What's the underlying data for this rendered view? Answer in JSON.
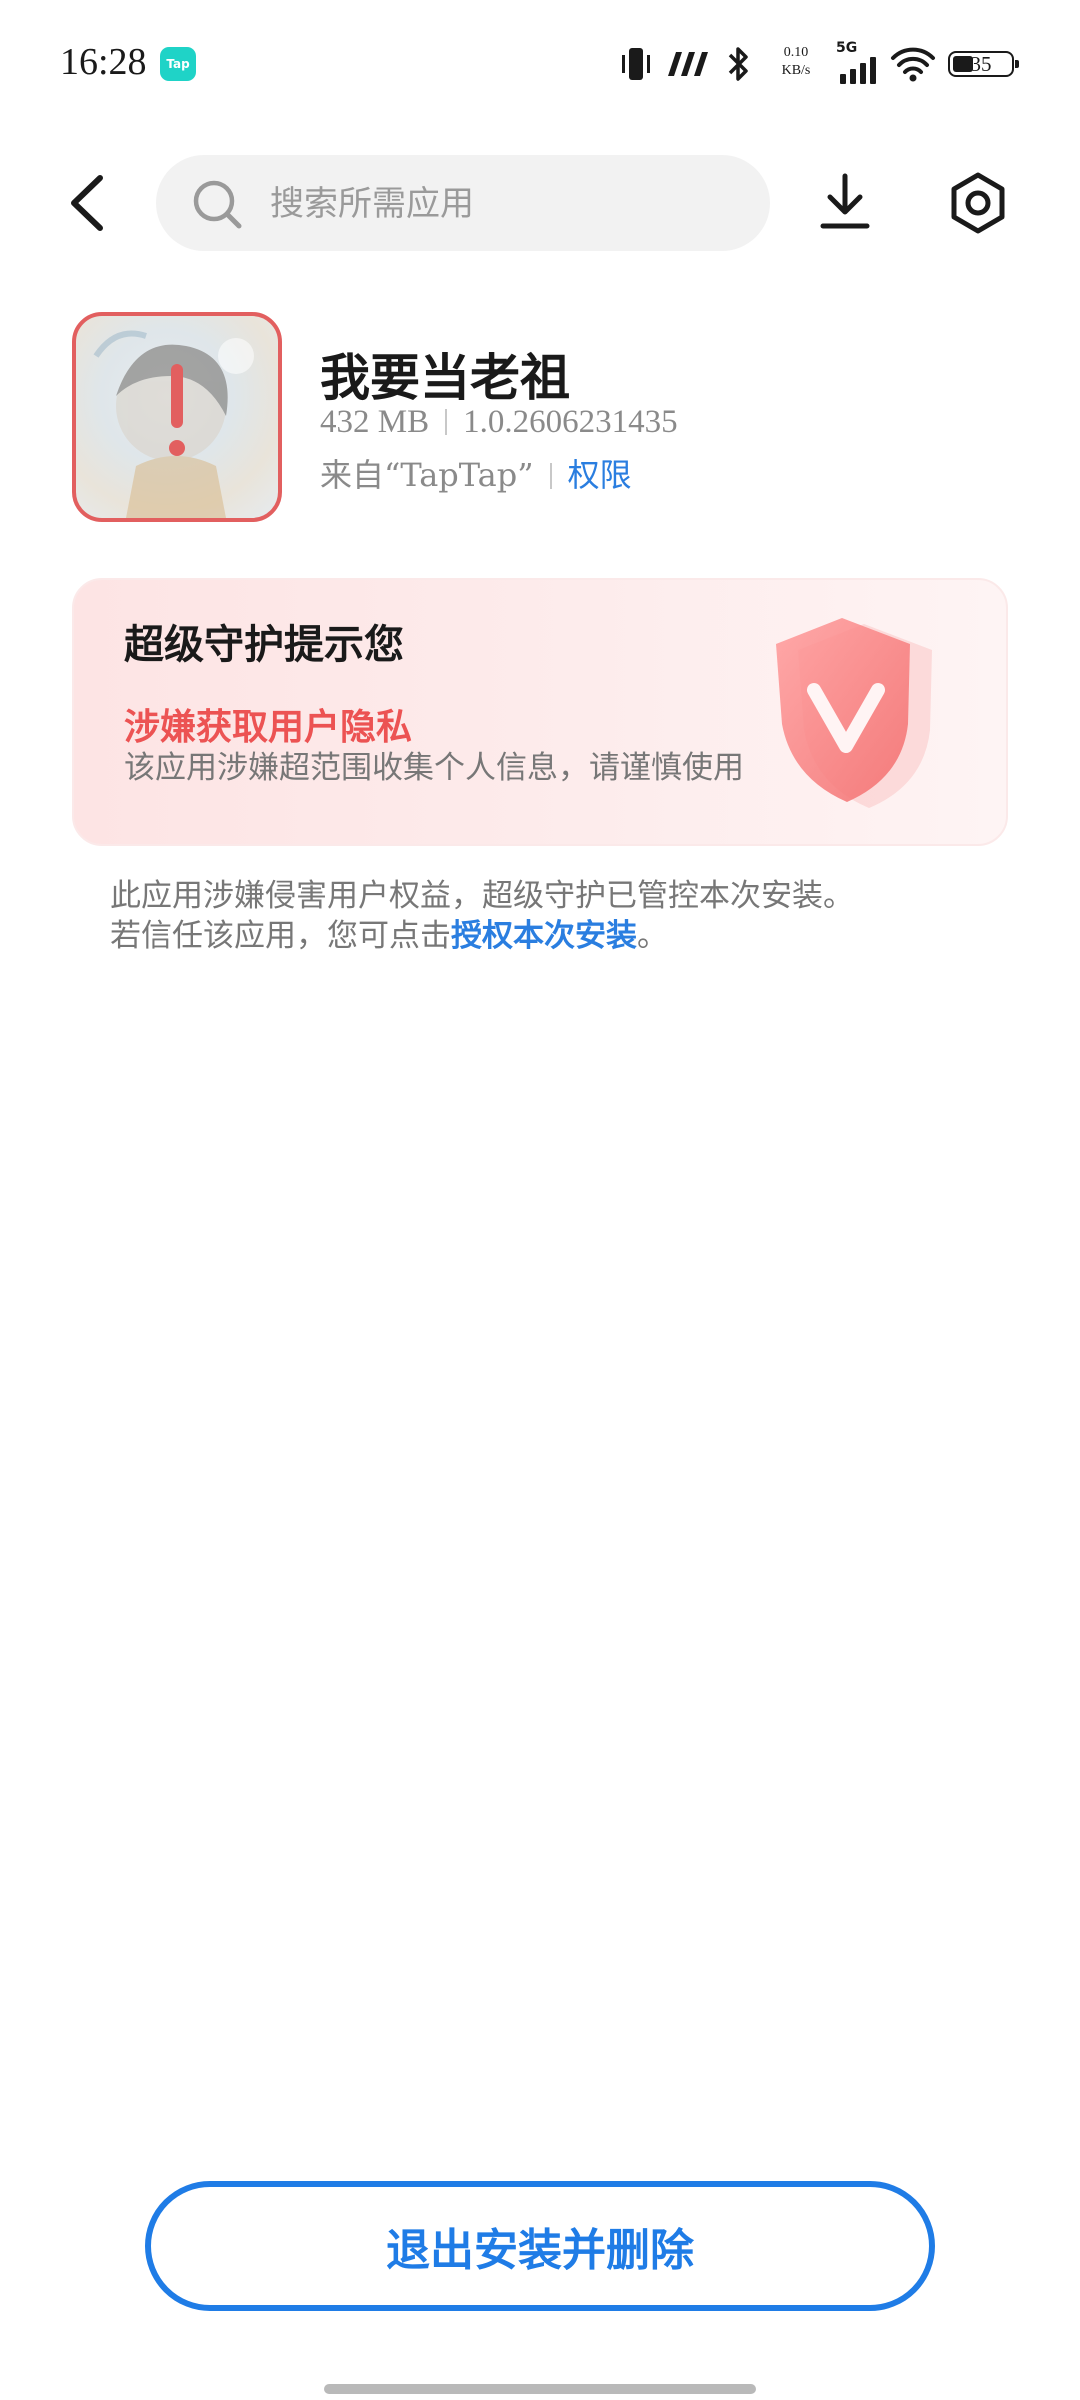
{
  "status_bar": {
    "time": "16:28",
    "taptap_badge": "Tap",
    "net_speed_value": "0.10",
    "net_speed_unit": "KB/s",
    "network_type": "5G",
    "battery": "35",
    "battery_level_percent": 35
  },
  "search": {
    "placeholder": "搜索所需应用"
  },
  "app": {
    "name": "我要当老祖",
    "size": "432 MB",
    "version": "1.0.2606231435",
    "source": "来自“TapTap”",
    "permissions_link": "权限"
  },
  "warning_card": {
    "title": "超级守护提示您",
    "subtitle": "涉嫌获取用户隐私",
    "description": "该应用涉嫌超范围收集个人信息，请谨慎使用"
  },
  "notice": {
    "line1": "此应用涉嫌侵害用户权益，超级守护已管控本次安装。",
    "line2_prefix": "若信任该应用，您可点击",
    "authorize_link": "授权本次安装",
    "line2_suffix": "。"
  },
  "actions": {
    "exit_button": "退出安装并删除"
  },
  "colors": {
    "accent_blue": "#1f7ce6",
    "warning_red": "#ec5353",
    "card_background": "#fde4e4"
  }
}
